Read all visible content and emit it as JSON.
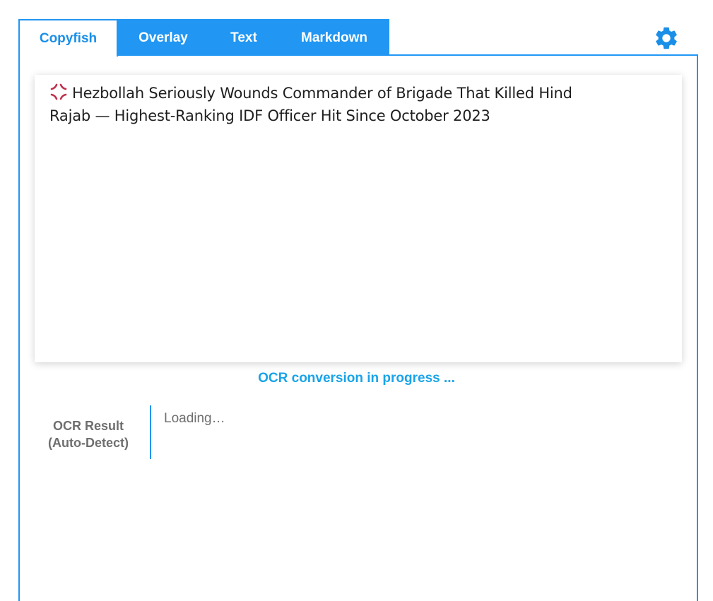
{
  "tabs": [
    {
      "label": "Copyfish",
      "active": true
    },
    {
      "label": "Overlay",
      "active": false
    },
    {
      "label": "Text",
      "active": false
    },
    {
      "label": "Markdown",
      "active": false
    }
  ],
  "settings": {
    "icon": "gear-icon"
  },
  "preview": {
    "icon": "anger-symbol-icon",
    "text": "Hezbollah Seriously Wounds Commander of Brigade That Killed Hind Rajab — Highest-Ranking IDF Officer Hit Since October 2023"
  },
  "status": {
    "text": "OCR conversion in progress ..."
  },
  "result": {
    "label_line1": "OCR Result",
    "label_line2": "(Auto-Detect)",
    "value": "Loading…"
  },
  "colors": {
    "accent": "#2196f3",
    "active_tab_text": "#1a8fe8",
    "status_text": "#1aa3e8",
    "muted_text": "#6f6f6f"
  }
}
